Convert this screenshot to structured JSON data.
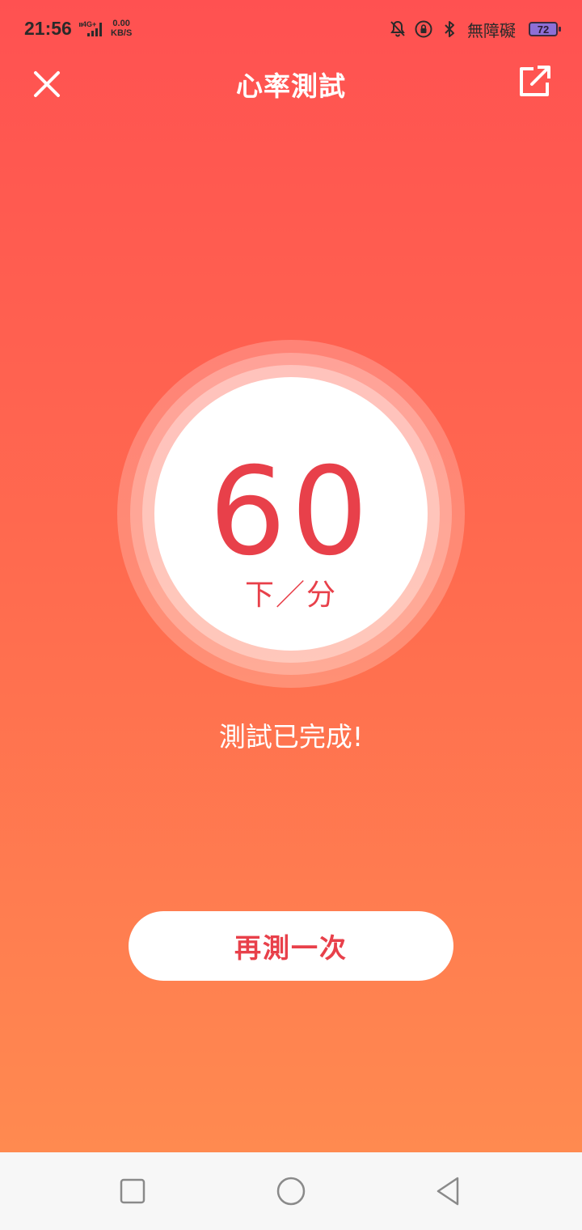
{
  "status_bar": {
    "time": "21:56",
    "network": "4G+",
    "speed_value": "0.00",
    "speed_unit": "KB/S",
    "accessibility": "無障礙",
    "battery": "72",
    "icons": [
      "silent-bell-icon",
      "rotation-lock-icon",
      "bluetooth-icon"
    ]
  },
  "header": {
    "title": "心率測試",
    "close_icon": "close-icon",
    "share_icon": "share-icon"
  },
  "result": {
    "bpm": "60",
    "unit": "下／分",
    "message": "測試已完成!"
  },
  "actions": {
    "retest_label": "再測一次"
  },
  "nav": {
    "icons": [
      "recent-apps-icon",
      "home-icon",
      "back-icon"
    ]
  },
  "colors": {
    "gradient_top": "#ff5151",
    "gradient_bottom": "#ff8a50",
    "accent_red": "#e8404a",
    "white": "#ffffff"
  }
}
